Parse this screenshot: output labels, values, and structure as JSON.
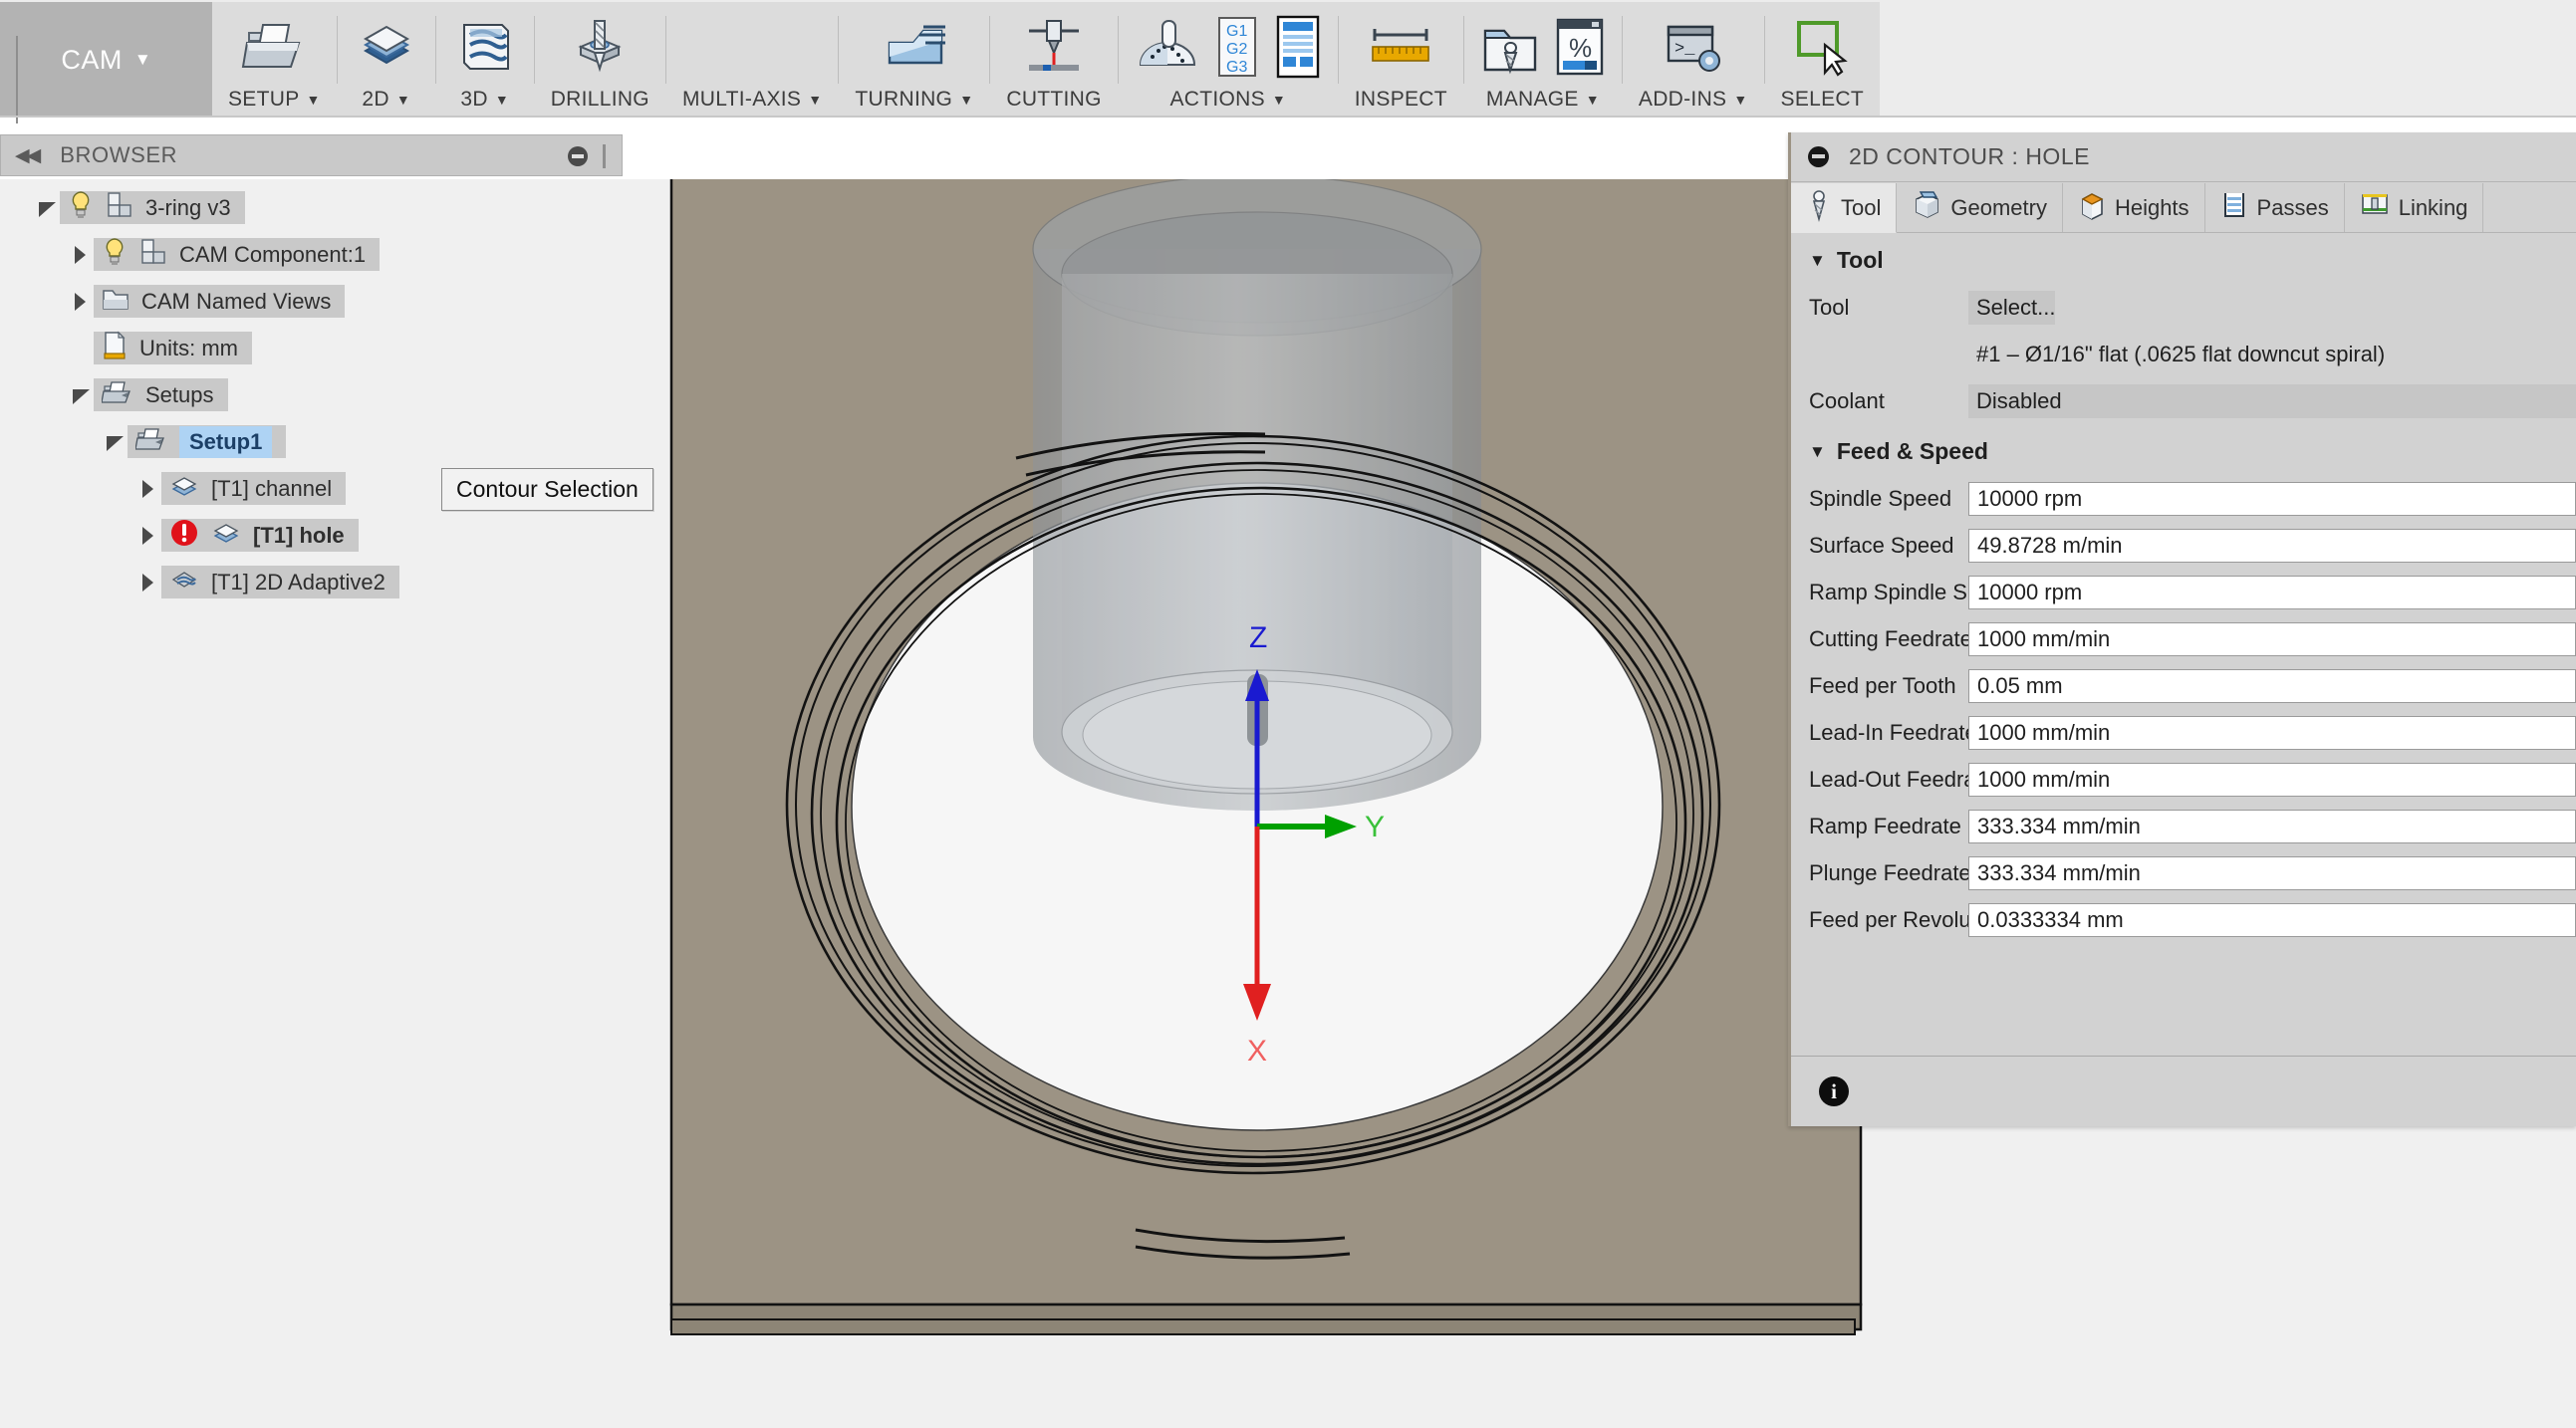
{
  "ribbon": {
    "workspace": {
      "label": "CAM",
      "caret": "▼",
      "icon": "workspace-grip-icon"
    },
    "groups": [
      {
        "label": "SETUP",
        "caret": "▼",
        "icon": "setup-icon"
      },
      {
        "label": "2D",
        "caret": "▼",
        "icon": "2d-icon"
      },
      {
        "label": "3D",
        "caret": "▼",
        "icon": "3d-icon"
      },
      {
        "label": "DRILLING",
        "caret": "",
        "icon": "drilling-icon"
      },
      {
        "label": "MULTI-AXIS",
        "caret": "▼",
        "icon": "multi-axis-icon"
      },
      {
        "label": "TURNING",
        "caret": "▼",
        "icon": "turning-icon"
      },
      {
        "label": "CUTTING",
        "caret": "",
        "icon": "cutting-icon"
      },
      {
        "label": "ACTIONS",
        "caret": "▼",
        "icon": "actions-icon"
      },
      {
        "label": "INSPECT",
        "caret": "",
        "icon": "inspect-ruler-icon"
      },
      {
        "label": "MANAGE",
        "caret": "▼",
        "icon": "manage-icon"
      },
      {
        "label": "ADD-INS",
        "caret": "▼",
        "icon": "add-ins-icon"
      },
      {
        "label": "SELECT",
        "caret": "",
        "icon": "select-cursor-icon"
      }
    ],
    "actions_gcode_label": "G1 G2 G3"
  },
  "browser": {
    "title": "BROWSER",
    "collapse_icon": "double-left-arrow-icon",
    "minimize_icon": "minimize-icon",
    "tree": [
      {
        "label": "3-ring v3",
        "indent": 0,
        "arrow": "open",
        "icons": [
          "lightbulb-icon",
          "component-icon"
        ],
        "selected": false,
        "bold": false,
        "warning": false
      },
      {
        "label": "CAM Component:1",
        "indent": 1,
        "arrow": "closed",
        "icons": [
          "lightbulb-icon",
          "component-icon"
        ],
        "selected": false,
        "bold": false,
        "warning": false
      },
      {
        "label": "CAM Named Views",
        "indent": 1,
        "arrow": "closed",
        "icons": [
          "folder-icon"
        ],
        "selected": false,
        "bold": false,
        "warning": false
      },
      {
        "label": "Units: mm",
        "indent": 1,
        "arrow": "none",
        "icons": [
          "document-ruler-icon"
        ],
        "selected": false,
        "bold": false,
        "warning": false
      },
      {
        "label": "Setups",
        "indent": 1,
        "arrow": "open",
        "icons": [
          "setups-icon"
        ],
        "selected": false,
        "bold": false,
        "warning": false
      },
      {
        "label": "Setup1",
        "indent": 2,
        "arrow": "open",
        "icons": [
          "setups-icon"
        ],
        "selected": true,
        "bold": true,
        "warning": false
      },
      {
        "label": "[T1] channel",
        "indent": 3,
        "arrow": "closed",
        "icons": [
          "contour-2d-icon"
        ],
        "selected": false,
        "bold": false,
        "warning": false
      },
      {
        "label": "[T1] hole",
        "indent": 3,
        "arrow": "closed",
        "icons": [
          "contour-2d-icon"
        ],
        "selected": false,
        "bold": true,
        "warning": true
      },
      {
        "label": "[T1] 2D Adaptive2",
        "indent": 3,
        "arrow": "closed",
        "icons": [
          "adaptive-2d-icon"
        ],
        "selected": false,
        "bold": false,
        "warning": false
      }
    ]
  },
  "tooltip": {
    "text": "Contour Selection"
  },
  "viewport": {
    "origin_axes": {
      "x_label": "X",
      "y_label": "Y",
      "z_label": "Z",
      "x_color": "#e02020",
      "y_color": "#00a000",
      "z_color": "#1a1ad0"
    },
    "stock_color": "#9c9384",
    "background_color": "#f0f0f0",
    "model_color": "#b8bcc0",
    "toolpath_color": "#1a1a1a"
  },
  "panel": {
    "title": "2D CONTOUR : HOLE",
    "minimize_icon": "minimize-icon",
    "tabs": [
      {
        "label": "Tool",
        "icon": "tool-icon",
        "active": true
      },
      {
        "label": "Geometry",
        "icon": "geometry-icon",
        "active": false
      },
      {
        "label": "Heights",
        "icon": "heights-icon",
        "active": false
      },
      {
        "label": "Passes",
        "icon": "passes-icon",
        "active": false
      },
      {
        "label": "Linking",
        "icon": "linking-icon",
        "active": false
      }
    ],
    "sections": [
      {
        "title": "Tool",
        "collapsed_icon": "▼",
        "rows": [
          {
            "label": "Tool",
            "value": "Select...",
            "style": "greybtn"
          },
          {
            "label": "",
            "value": "#1 – Ø1/16\" flat (.0625 flat downcut spiral)",
            "style": "plain"
          },
          {
            "label": "Coolant",
            "value": "Disabled",
            "style": "greyfull"
          }
        ]
      },
      {
        "title": "Feed & Speed",
        "collapsed_icon": "▼",
        "rows": [
          {
            "label": "Spindle Speed",
            "value": "10000 rpm",
            "style": "input"
          },
          {
            "label": "Surface Speed",
            "value": "49.8728 m/min",
            "style": "input"
          },
          {
            "label": "Ramp Spindle Speed",
            "value": "10000 rpm",
            "style": "input"
          },
          {
            "label": "Cutting Feedrate",
            "value": "1000 mm/min",
            "style": "input"
          },
          {
            "label": "Feed per Tooth",
            "value": "0.05 mm",
            "style": "input"
          },
          {
            "label": "Lead-In Feedrate",
            "value": "1000 mm/min",
            "style": "input"
          },
          {
            "label": "Lead-Out Feedrate",
            "value": "1000 mm/min",
            "style": "input"
          },
          {
            "label": "Ramp Feedrate",
            "value": "333.334 mm/min",
            "style": "input"
          },
          {
            "label": "Plunge Feedrate",
            "value": "333.334 mm/min",
            "style": "input"
          },
          {
            "label": "Feed per Revolution",
            "value": "0.0333334 mm",
            "style": "input"
          }
        ]
      }
    ],
    "footer": {
      "info_icon": "info-icon",
      "info_label": "i"
    }
  }
}
